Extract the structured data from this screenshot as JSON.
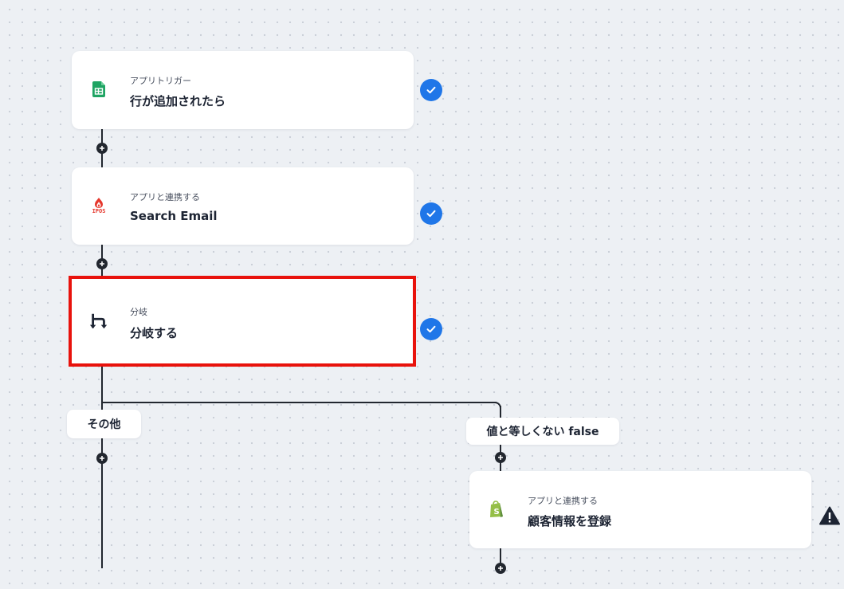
{
  "flow": {
    "steps": [
      {
        "subtitle": "アプリトリガー",
        "title": "行が追加されたら",
        "icon": "google-sheets-icon",
        "status": "complete"
      },
      {
        "subtitle": "アプリと連携する",
        "title": "Search Email",
        "icon": "ipos-icon",
        "icon_text": "IPOS",
        "status": "complete"
      },
      {
        "subtitle": "分岐",
        "title": "分岐する",
        "icon": "branch-icon",
        "status": "complete",
        "selected": true
      },
      {
        "subtitle": "アプリと連携する",
        "title": "顧客情報を登録",
        "icon": "shopify-icon",
        "status": "warning"
      }
    ],
    "branches": [
      {
        "label": "その他"
      },
      {
        "label": "値と等しくない false"
      }
    ]
  },
  "colors": {
    "accent": "#1f76e8",
    "highlight": "#e8120c",
    "sheets_green": "#1fa463",
    "shopify_green": "#95bf47",
    "ipos_red": "#e5362b"
  }
}
